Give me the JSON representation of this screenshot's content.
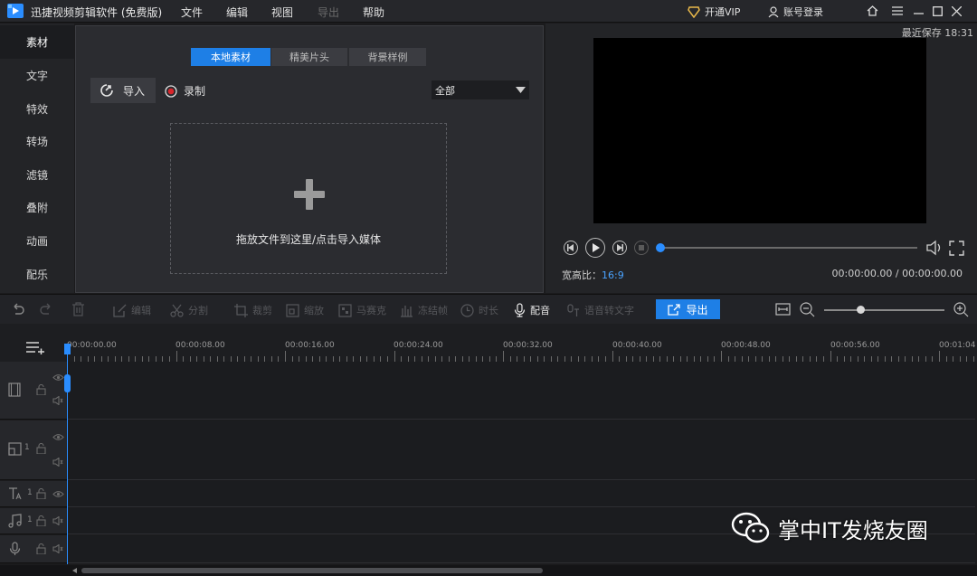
{
  "titlebar": {
    "app_title": "迅捷视频剪辑软件 (免费版)",
    "menus": [
      "文件",
      "编辑",
      "视图",
      "导出",
      "帮助"
    ],
    "vip_label": "开通VIP",
    "login_label": "账号登录"
  },
  "sidebar": {
    "items": [
      "素材",
      "文字",
      "特效",
      "转场",
      "滤镜",
      "叠附",
      "动画",
      "配乐"
    ],
    "active": "素材"
  },
  "media": {
    "tabs": [
      "本地素材",
      "精美片头",
      "背景样例"
    ],
    "active_tab": "本地素材",
    "import_label": "导入",
    "record_label": "录制",
    "filter_value": "全部",
    "drop_hint": "拖放文件到这里/点击导入媒体"
  },
  "preview": {
    "autosave": "最近保存 18:31",
    "aspect_label": "宽高比：",
    "aspect_value": "16:9",
    "timecode": "00:00:00.00 / 00:00:00.00",
    "progress": 0
  },
  "toolbar": {
    "tools": [
      "编辑",
      "分割",
      "裁剪",
      "缩放",
      "马赛克",
      "冻结帧",
      "时长",
      "配音",
      "语音转文字"
    ],
    "export_label": "导出",
    "zoom_level": 0.3
  },
  "timeline": {
    "ticks": [
      "00:00:00.00",
      "00:00:08.00",
      "00:00:16.00",
      "00:00:24.00",
      "00:00:32.00",
      "00:00:40.00",
      "00:00:48.00",
      "00:00:56.00",
      "00:01:04"
    ],
    "track_numbers": [
      "1",
      "1",
      "1"
    ]
  },
  "watermark": "掌中IT发烧友圈",
  "colors": {
    "accent": "#1e7fe6",
    "vip_gold": "#e8b84a",
    "record_red": "#d9252b"
  }
}
